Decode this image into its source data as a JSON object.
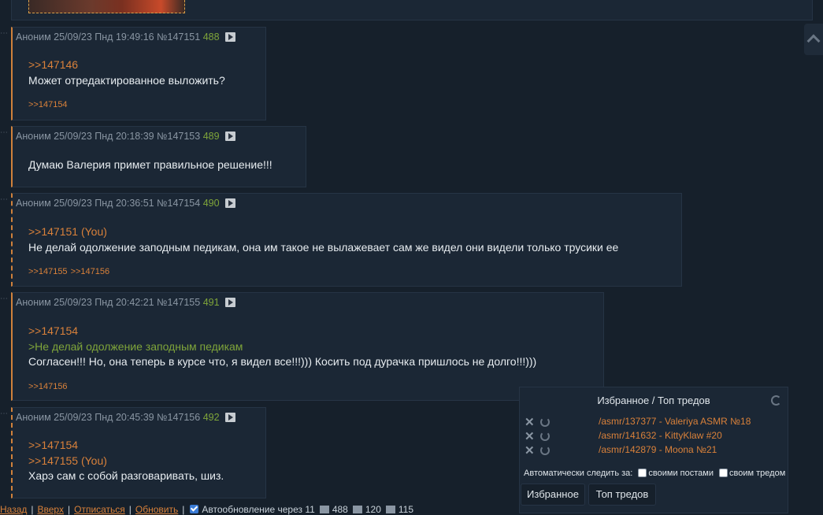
{
  "posts": [
    {
      "author": "Аноним",
      "date": "25/09/23 Пнд 19:49:16",
      "id": "№147151",
      "num": "488",
      "refs": [
        ">>147146"
      ],
      "green": [],
      "text": "Может отредактированное выложить?",
      "replies": [
        ">>147154"
      ]
    },
    {
      "author": "Аноним",
      "date": "25/09/23 Пнд 20:18:39",
      "id": "№147153",
      "num": "489",
      "refs": [],
      "green": [],
      "text": "Думаю Валерия примет правильное решение!!!",
      "replies": []
    },
    {
      "author": "Аноним",
      "date": "25/09/23 Пнд 20:36:51",
      "id": "№147154",
      "num": "490",
      "refs": [
        ">>147151 (You)"
      ],
      "green": [],
      "text": "Не делай одолжение заподным педикам, она им такое не вылажевает сам же видел они видели только трусики ее",
      "replies": [
        ">>147155",
        ">>147156"
      ]
    },
    {
      "author": "Аноним",
      "date": "25/09/23 Пнд 20:42:21",
      "id": "№147155",
      "num": "491",
      "refs": [
        ">>147154"
      ],
      "green": [
        ">Не делай одолжение заподным педикам"
      ],
      "text": "Согласен!!! Но, она теперь в курсе что, я видел все!!!))) Косить под дурачка пришлось не долго!!!)))",
      "replies": [
        ">>147156"
      ]
    },
    {
      "author": "Аноним",
      "date": "25/09/23 Пнд 20:45:39",
      "id": "№147156",
      "num": "492",
      "refs": [
        ">>147154",
        ">>147155 (You)"
      ],
      "green": [],
      "text": "Харэ сам с собой разговаривать, шиз.",
      "replies": []
    }
  ],
  "favorites": {
    "title": "Избранное / Топ тредов",
    "items": [
      {
        "link": "/asmr/137377 - Valeriya ASMR №18"
      },
      {
        "link": "/asmr/141632 - KittyKlaw #20"
      },
      {
        "link": "/asmr/142879 - Moona №21"
      }
    ],
    "auto_label": "Автоматически следить за:",
    "opt_posts": "своими постами",
    "opt_thread": "своим тредом",
    "tab_fav": "Избранное",
    "tab_top": "Топ тредов"
  },
  "bottom": {
    "back": "Назад",
    "up": "Вверх",
    "unsubscribe": "Отписаться",
    "refresh": "Обновить",
    "autoupdate": "Автообновление через 11",
    "posts_count": "488",
    "files_count": "120",
    "users_count": "115"
  },
  "icons": [
    "play-icon",
    "close-icon",
    "refresh-icon",
    "chevron-up-icon",
    "checkbox-icon"
  ]
}
